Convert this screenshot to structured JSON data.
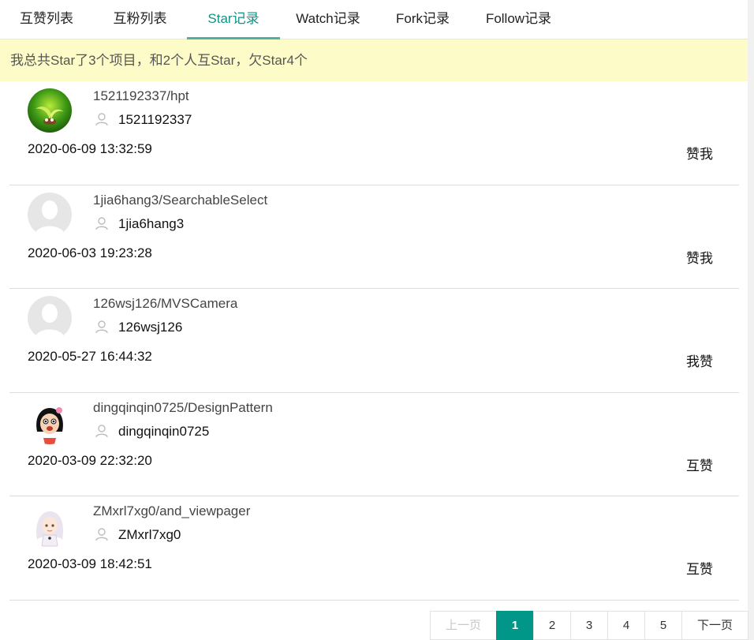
{
  "tabs": [
    {
      "label": "互赞列表",
      "active": false
    },
    {
      "label": "互粉列表",
      "active": false
    },
    {
      "label": "Star记录",
      "active": true
    },
    {
      "label": "Watch记录",
      "active": false
    },
    {
      "label": "Fork记录",
      "active": false
    },
    {
      "label": "Follow记录",
      "active": false
    }
  ],
  "notice": "我总共Star了3个项目，和2个人互Star，欠Star4个",
  "records": [
    {
      "repo": "1521192337/hpt",
      "owner": "1521192337",
      "time": "2020-06-09 13:32:59",
      "relation": "赞我",
      "avatar": "green-sprout-avatar"
    },
    {
      "repo": "1jia6hang3/SearchableSelect",
      "owner": "1jia6hang3",
      "time": "2020-06-03 19:23:28",
      "relation": "赞我",
      "avatar": "default-avatar"
    },
    {
      "repo": "126wsj126/MVSCamera",
      "owner": "126wsj126",
      "time": "2020-05-27 16:44:32",
      "relation": "我赞",
      "avatar": "default-avatar"
    },
    {
      "repo": "dingqinqin0725/DesignPattern",
      "owner": "dingqinqin0725",
      "time": "2020-03-09 22:32:20",
      "relation": "互赞",
      "avatar": "cartoon-girl-avatar"
    },
    {
      "repo": "ZMxrl7xg0/and_viewpager",
      "owner": "ZMxrl7xg0",
      "time": "2020-03-09 18:42:51",
      "relation": "互赞",
      "avatar": "anime-girl-avatar"
    }
  ],
  "pagination": {
    "prev": "上一页",
    "pages": [
      "1",
      "2",
      "3",
      "4",
      "5"
    ],
    "current": "1",
    "next": "下一页"
  },
  "colors": {
    "accent": "#009688",
    "active_tab_text": "#149287",
    "notice_bg": "#fdfcc9"
  }
}
